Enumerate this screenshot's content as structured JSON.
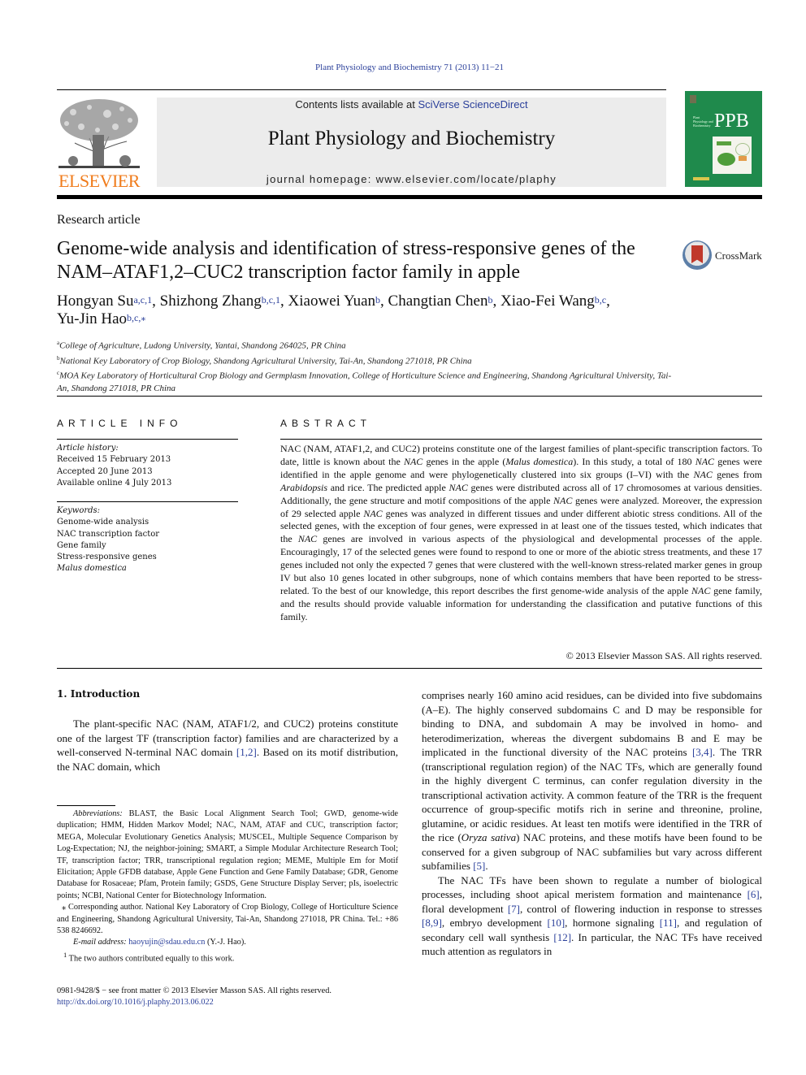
{
  "running_head": "Plant Physiology and Biochemistry 71 (2013) 11−21",
  "masthead": {
    "publisher": "ELSEVIER",
    "contents_prefix": "Contents lists available at ",
    "contents_link": "SciVerse ScienceDirect",
    "journal_name": "Plant Physiology and Biochemistry",
    "homepage_prefix": "journal homepage: ",
    "homepage_url": "www.elsevier.com/locate/plaphy",
    "cover_abbrev": "PPB",
    "cover_small": "Plant Physiology and Biochemistry",
    "publisher_color": "#f07c1c",
    "link_color": "#2a3f9a",
    "cover_color": "#1f8a4c"
  },
  "article": {
    "type": "Research article",
    "title": "Genome-wide analysis and identification of stress-responsive genes of the NAM–ATAF1,2–CUC2 transcription factor family in apple",
    "crossmark": "CrossMark",
    "authors": [
      {
        "name": "Hongyan Su",
        "aff": "a,c,1",
        "sep": ", "
      },
      {
        "name": "Shizhong Zhang",
        "aff": "b,c,1",
        "sep": ", "
      },
      {
        "name": "Xiaowei Yuan",
        "aff": "b",
        "sep": ", "
      },
      {
        "name": "Changtian Chen",
        "aff": "b",
        "sep": ", "
      },
      {
        "name": "Xiao-Fei Wang",
        "aff": "b,c",
        "sep": ","
      },
      {
        "name": "Yu-Jin Hao",
        "aff": "b,c,⁎",
        "sep": ""
      }
    ],
    "affiliations": [
      {
        "label": "a",
        "text": "College of Agriculture, Ludong University, Yantai, Shandong 264025, PR China"
      },
      {
        "label": "b",
        "text": "National Key Laboratory of Crop Biology, Shandong Agricultural University, Tai-An, Shandong 271018, PR China"
      },
      {
        "label": "c",
        "text": "MOA Key Laboratory of Horticultural Crop Biology and Germplasm Innovation, College of Horticulture Science and Engineering, Shandong Agricultural University, Tai-An, Shandong 271018, PR China"
      }
    ]
  },
  "article_info": {
    "heading": "ARTICLE INFO",
    "history_label": "Article history:",
    "received": "Received 15 February 2013",
    "accepted": "Accepted 20 June 2013",
    "online": "Available online 4 July 2013",
    "keywords_label": "Keywords:",
    "keywords": [
      "Genome-wide analysis",
      "NAC transcription factor",
      "Gene family",
      "Stress-responsive genes",
      "Malus domestica"
    ]
  },
  "abstract": {
    "heading": "ABSTRACT",
    "segments": [
      {
        "t": "NAC (NAM, ATAF1,2, and CUC2) proteins constitute one of the largest families of plant-specific tran­scription factors. To date, little is known about the "
      },
      {
        "t": "NAC",
        "i": true
      },
      {
        "t": " genes in the apple ("
      },
      {
        "t": "Malus domestica",
        "i": true
      },
      {
        "t": "). In this study, a total of 180 "
      },
      {
        "t": "NAC",
        "i": true
      },
      {
        "t": " genes were identified in the apple genome and were phylogenetically clustered into six groups (I–VI) with the "
      },
      {
        "t": "NAC",
        "i": true
      },
      {
        "t": " genes from "
      },
      {
        "t": "Arabidopsis",
        "i": true
      },
      {
        "t": " and rice. The predicted apple "
      },
      {
        "t": "NAC",
        "i": true
      },
      {
        "t": " genes were distributed across all of 17 chromosomes at various densities. Additionally, the gene structure and motif compositions of the apple "
      },
      {
        "t": "NAC",
        "i": true
      },
      {
        "t": " genes were analyzed. Moreover, the expression of 29 selected apple "
      },
      {
        "t": "NAC",
        "i": true
      },
      {
        "t": " genes was analyzed in different tissues and under different abiotic stress conditions. All of the selected genes, with the exception of four genes, were expressed in at least one of the tissues tested, which in­dicates that the "
      },
      {
        "t": "NAC",
        "i": true
      },
      {
        "t": " genes are involved in various aspects of the physiological and developmental processes of the apple. Encouragingly, 17 of the selected genes were found to respond to one or more of the abiotic stress treatments, and these 17 genes included not only the expected 7 genes that were clustered with the well-known stress-related marker genes in group IV but also 10 genes located in other subgroups, none of which contains members that have been reported to be stress-related. To the best of our knowledge, this report describes the first genome-wide analysis of the apple "
      },
      {
        "t": "NAC",
        "i": true
      },
      {
        "t": " gene family, and the results should provide valuable information for understanding the classification and putative func­tions of this family."
      }
    ],
    "copyright": "© 2013 Elsevier Masson SAS. All rights reserved."
  },
  "introduction": {
    "heading": "1.  Introduction",
    "left_paragraph": [
      {
        "t": "The plant-specific NAC (NAM, ATAF1/2, and CUC2) proteins constitute one of the largest TF (transcription factor) families and are characterized by a well-conserved N-terminal NAC domain "
      },
      {
        "t": "[1,2]",
        "link": true
      },
      {
        "t": ". Based on its motif distribution, the NAC domain, which"
      }
    ],
    "right_paragraph_1": [
      {
        "t": "comprises nearly 160 amino acid residues, can be divided into five subdomains (A–E). The highly conserved subdomains C and D may be responsible for binding to DNA, and subdomain A may be involved in homo- and heterodimerization, whereas the divergent subdomains B and E may be implicated in the functional diversity of the NAC proteins "
      },
      {
        "t": "[3,4]",
        "link": true
      },
      {
        "t": ". The TRR (transcriptional regulation region) of the NAC TFs, which are generally found in the highly divergent C terminus, can confer regulation diversity in the transcriptional activation activity. A common feature of the TRR is the frequent occurrence of group-specific motifs rich in serine and threonine, proline, glutamine, or acidic residues. At least ten motifs were identified in the TRR of the rice ("
      },
      {
        "t": "Oryza sativa",
        "i": true
      },
      {
        "t": ") NAC proteins, and these motifs have been found to be conserved for a given subgroup of NAC subfamilies but vary across different subfamilies "
      },
      {
        "t": "[5]",
        "link": true
      },
      {
        "t": "."
      }
    ],
    "right_paragraph_2": [
      {
        "t": "The NAC TFs have been shown to regulate a number of biological processes, including shoot apical meristem formation and mainte­nance "
      },
      {
        "t": "[6]",
        "link": true
      },
      {
        "t": ", floral development "
      },
      {
        "t": "[7]",
        "link": true
      },
      {
        "t": ", control of flowering induction in response to stresses "
      },
      {
        "t": "[8,9]",
        "link": true
      },
      {
        "t": ", embryo development "
      },
      {
        "t": "[10]",
        "link": true
      },
      {
        "t": ", hormone signaling "
      },
      {
        "t": "[11]",
        "link": true
      },
      {
        "t": ", and regulation of secondary cell wall synthesis "
      },
      {
        "t": "[12]",
        "link": true
      },
      {
        "t": ". In particular, the NAC TFs have received much attention as regulators in"
      }
    ]
  },
  "footnotes": {
    "abbreviations_label": "Abbreviations:",
    "abbreviations": " BLAST, the Basic Local Alignment Search Tool; GWD, genome-wide duplication; HMM, Hidden Markov Model; NAC, NAM, ATAF and CUC, tran­scription factor; MEGA, Molecular Evolutionary Genetics Analysis; MUSCEL, Mul­tiple Sequence Comparison by Log-Expectation; NJ, the neighbor-joining; SMART, a Simple Modular Architecture Research Tool; TF, transcription factor; TRR, tran­scriptional regulation region; MEME, Multiple Em for Motif Elicitation; Apple GFDB database, Apple Gene Function and Gene Family Database; GDR, Genome Database for Rosaceae; Pfam, Protein family; GSDS, Gene Structure Display Server; pIs, iso­electric points; NCBI, National Center for Biotechnology Information.",
    "corresponding": "⁎ Corresponding author. National Key Laboratory of Crop Biology, College of Horticulture Science and Engineering, Shandong Agricultural University, Tai-An, Shandong 271018, PR China. Tel.: +86 538 8246692.",
    "email_label": "E-mail address:",
    "email": "haoyujin@sdau.edu.cn",
    "email_suffix": " (Y.-J. Hao).",
    "equal_contrib_mark": "1",
    "equal_contrib": " The two authors contributed equally to this work."
  },
  "front_matter": {
    "issn_line": "0981-9428/$ − see front matter © 2013 Elsevier Masson SAS. All rights reserved.",
    "doi": "http://dx.doi.org/10.1016/j.plaphy.2013.06.022"
  }
}
